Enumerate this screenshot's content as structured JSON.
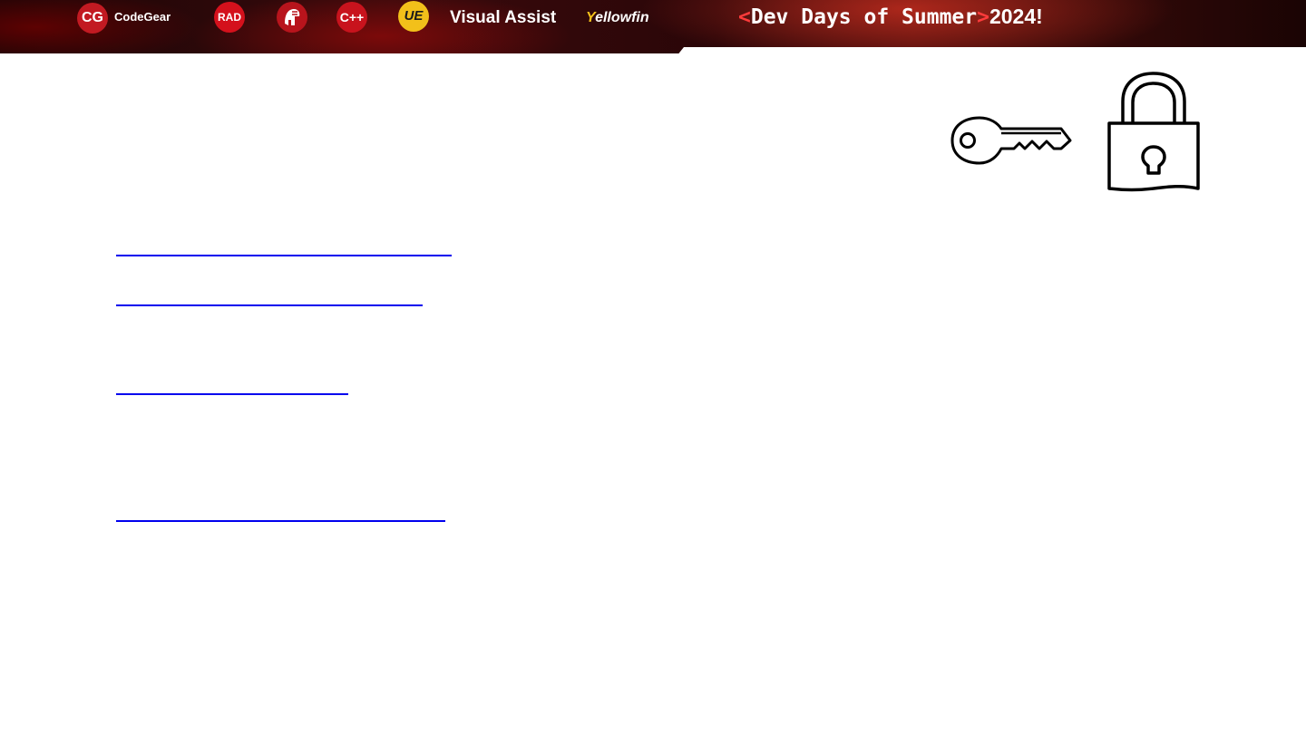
{
  "banner": {
    "codegear_mark": "CG",
    "codegear_label": "CodeGear",
    "rad_label": "RAD",
    "cpp_label": "C++",
    "ue_label": "UE",
    "visual_assist_label": "Visual Assist",
    "yellowfin_mark": "Y",
    "yellowfin_label": "ellowfin",
    "event": {
      "open_bracket": "<",
      "title": "Dev Days of Summer",
      "close_bracket": ">",
      "year": "2024!"
    }
  },
  "colors": {
    "banner_red": "#c21a22",
    "accent_red": "#ff3b3b",
    "ue_yellow": "#f2c01a",
    "link_blue": "#0000ee"
  },
  "icons": [
    "key-icon",
    "padlock-icon"
  ],
  "links": [
    {
      "label": ""
    },
    {
      "label": ""
    },
    {
      "label": ""
    },
    {
      "label": ""
    }
  ]
}
